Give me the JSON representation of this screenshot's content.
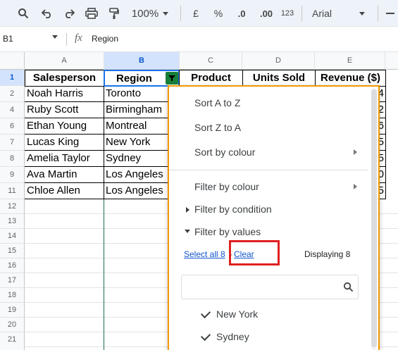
{
  "toolbar": {
    "search_icon": "search-icon",
    "zoom": "100%",
    "currency": "£",
    "percent": "%",
    "decrease_decimals": ".0",
    "increase_decimals": ".00",
    "number_format": "123",
    "font": "Arial",
    "undo_icon": "undo-icon",
    "redo_icon": "redo-icon",
    "print_icon": "print-icon",
    "paint_format_icon": "paint-format-icon"
  },
  "formula_bar": {
    "cell_ref": "B1",
    "fx": "fx",
    "value": "Region"
  },
  "columns": [
    "A",
    "B",
    "C",
    "D",
    "E"
  ],
  "rows": [
    "1",
    "2",
    "4",
    "6",
    "7",
    "8",
    "9",
    "11",
    "12",
    "13",
    "14",
    "15",
    "16",
    "17",
    "18",
    "19",
    "20",
    "21"
  ],
  "headers": [
    "Salesperson",
    "Region",
    "Product",
    "Units Sold",
    "Revenue ($)"
  ],
  "data": [
    {
      "name": "Noah Harris",
      "region": "Toronto",
      "rev_tail": "4"
    },
    {
      "name": "Ruby Scott",
      "region": "Birmingham",
      "rev_tail": "2"
    },
    {
      "name": "Ethan Young",
      "region": "Montreal",
      "rev_tail": "6"
    },
    {
      "name": "Lucas King",
      "region": "New York",
      "rev_tail": "5"
    },
    {
      "name": "Amelia Taylor",
      "region": "Sydney",
      "rev_tail": "5"
    },
    {
      "name": "Ava Martin",
      "region": "Los Angeles",
      "rev_tail": "0"
    },
    {
      "name": "Chloe Allen",
      "region": "Los Angeles",
      "rev_tail": "5"
    }
  ],
  "menu": {
    "sort_az": "Sort A to Z",
    "sort_za": "Sort Z to A",
    "sort_colour": "Sort by colour",
    "filter_colour": "Filter by colour",
    "filter_condition": "Filter by condition",
    "filter_values": "Filter by values",
    "select_all": "Select all 8",
    "clear": "Clear",
    "displaying": "Displaying 8",
    "values": [
      "New York",
      "Sydney"
    ]
  },
  "colors": {
    "filter_green": "#188038",
    "menu_border": "#f29900",
    "highlight_red": "#e02020",
    "selected_header": "#d3e3fd"
  }
}
